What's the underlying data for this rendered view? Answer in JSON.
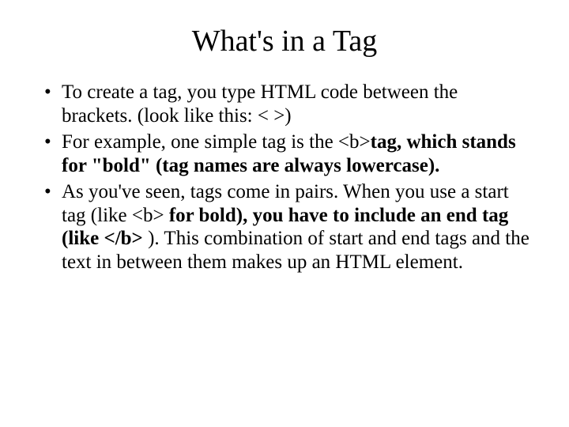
{
  "title": "What's in a Tag",
  "bullets": [
    {
      "runs": [
        {
          "text": "To create a tag, you type HTML code between the brackets. (look like this: < >)",
          "bold": false
        }
      ]
    },
    {
      "runs": [
        {
          "text": "For example, one simple tag is the <b>",
          "bold": false
        },
        {
          "text": "tag, which stands for \"bold\" (tag names are always lowercase).",
          "bold": true
        }
      ]
    },
    {
      "runs": [
        {
          "text": "As you've seen, tags come in pairs. When you use a start tag (like <b>",
          "bold": false
        },
        {
          "text": " for bold), you have to include an end tag (like </b> ",
          "bold": true
        },
        {
          "text": "). This combination of start and end tags and the text in between them makes up an HTML element.",
          "bold": false
        }
      ]
    }
  ]
}
